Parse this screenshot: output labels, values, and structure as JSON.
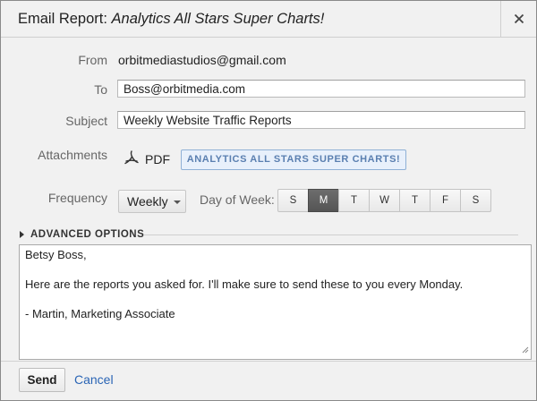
{
  "dialog": {
    "title_prefix": "Email Report: ",
    "report_name": "Analytics All Stars Super Charts!",
    "close_glyph": "✕"
  },
  "form": {
    "from_label": "From",
    "from_value": "orbitmediastudios@gmail.com",
    "to_label": "To",
    "to_value": "Boss@orbitmedia.com",
    "subject_label": "Subject",
    "subject_value": "Weekly Website Traffic Reports",
    "attachments_label": "Attachments",
    "attachment_format": "PDF",
    "attachment_name": "ANALYTICS ALL STARS SUPER CHARTS!",
    "frequency_label": "Frequency",
    "frequency_value": "Weekly",
    "day_of_week_label": "Day of Week:",
    "days": [
      "S",
      "M",
      "T",
      "W",
      "T",
      "F",
      "S"
    ],
    "selected_day": "M"
  },
  "advanced": {
    "label": "ADVANCED OPTIONS"
  },
  "message": {
    "lines": [
      "Betsy Boss,",
      "Here are the reports you asked for. I'll make sure to send these to you every Monday.",
      "- Martin, Marketing Associate"
    ]
  },
  "footer": {
    "send_label": "Send",
    "cancel_label": "Cancel"
  },
  "colors": {
    "accent_link": "#2a65b5",
    "selected_day_bg": "#5e5e5e",
    "chip_border": "#8fb0d6",
    "chip_text": "#5a7fb0"
  }
}
